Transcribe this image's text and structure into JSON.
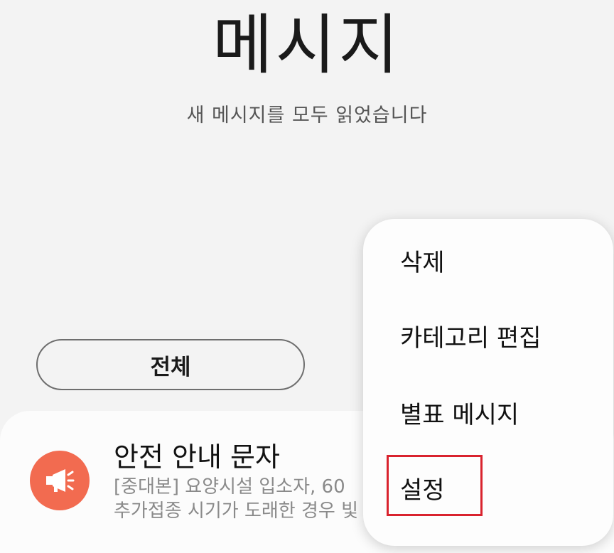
{
  "header": {
    "title": "메시지",
    "subtitle": "새 메시지를 모두 읽었습니다"
  },
  "filter": {
    "label": "전체"
  },
  "message": {
    "icon": "megaphone-icon",
    "title": "안전 안내 문자",
    "preview_line1": "[중대본] 요양시설 입소자, 60",
    "preview_line2": "추가접종 시기가 도래한 경우 빛"
  },
  "context_menu": {
    "items": [
      "삭제",
      "카테고리 편집",
      "별표 메시지",
      "설정"
    ],
    "highlighted_item": "설정"
  },
  "colors": {
    "background": "#f3f3f3",
    "icon_bg": "#f26b50",
    "highlight": "#d9232e"
  }
}
